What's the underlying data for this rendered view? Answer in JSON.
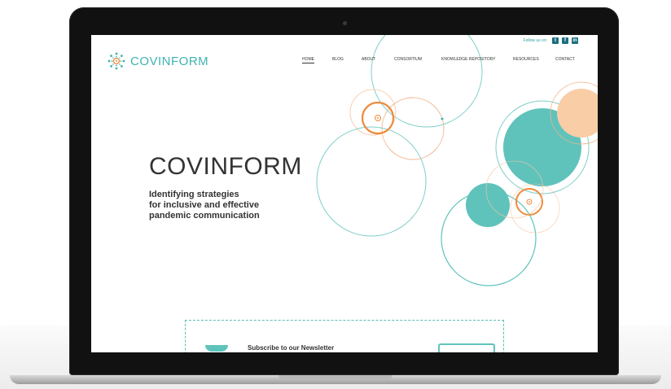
{
  "site": {
    "brand": "COVINFORM",
    "follow_label": "Follow us on:",
    "social_icons": [
      "twitter-icon",
      "facebook-icon",
      "linkedin-icon"
    ],
    "social_glyphs": [
      "t",
      "f",
      "in"
    ]
  },
  "nav": {
    "items": [
      "HOME",
      "BLOG",
      "ABOUT",
      "CONSORTIUM",
      "KNOWLEDGE REPOSITORY",
      "RESOURCES",
      "CONTACT"
    ],
    "active": "HOME"
  },
  "hero": {
    "title": "COVINFORM",
    "subtitle_lines": [
      "Identifying strategies",
      "for inclusive and effective",
      "pandemic communication"
    ]
  },
  "newsletter": {
    "label": "Subscribe to our Newsletter"
  },
  "colors": {
    "teal": "#5fc3bc",
    "orange": "#ee8a3a",
    "peach": "#f9cda6"
  }
}
